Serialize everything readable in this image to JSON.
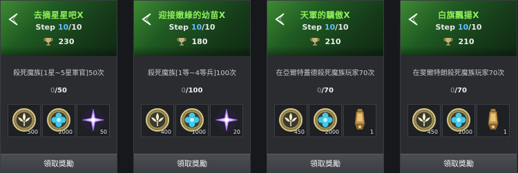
{
  "cards": [
    {
      "title": "去摘星星吧X",
      "step_prefix": "Step",
      "step_current": "10",
      "step_total": "/10",
      "points": "230",
      "description": "殺死魔族[1星~5星軍官]50次",
      "progress_current": "0",
      "progress_total": "/50",
      "rewards": [
        {
          "icon": "gold-leaf-coin-icon",
          "qty": "500"
        },
        {
          "icon": "blue-flower-coin-icon",
          "qty": "2000"
        },
        {
          "icon": "purple-star-crystal-icon",
          "qty": "50"
        }
      ],
      "claim_label": "領取獎勵"
    },
    {
      "title": "迎接嫩綠的幼苗X",
      "step_prefix": "Step",
      "step_current": "10",
      "step_total": "/10",
      "points": "180",
      "description": "殺死魔族[1等~4等兵]100次",
      "progress_current": "0",
      "progress_total": "/100",
      "rewards": [
        {
          "icon": "gold-leaf-coin-icon",
          "qty": "400"
        },
        {
          "icon": "blue-flower-coin-icon",
          "qty": "1000"
        },
        {
          "icon": "purple-star-crystal-icon",
          "qty": "20"
        }
      ],
      "claim_label": "領取獎勵"
    },
    {
      "title": "天軍的驕傲X",
      "step_prefix": "Step",
      "step_current": "10",
      "step_total": "/10",
      "points": "210",
      "description": "在亞爾特蓋德殺死魔族玩家70次",
      "progress_current": "0",
      "progress_total": "/70",
      "rewards": [
        {
          "icon": "gold-leaf-coin-icon",
          "qty": "450"
        },
        {
          "icon": "blue-flower-coin-icon",
          "qty": "2000"
        },
        {
          "icon": "bronze-lantern-scroll-icon",
          "qty": "1"
        }
      ],
      "claim_label": "領取獎勵"
    },
    {
      "title": "白旗飄揚X",
      "step_prefix": "Step",
      "step_current": "10",
      "step_total": "/10",
      "points": "210",
      "description": "在斐爾特朗殺死魔族玩家70次",
      "progress_current": "0",
      "progress_total": "/70",
      "rewards": [
        {
          "icon": "gold-leaf-coin-icon",
          "qty": "450"
        },
        {
          "icon": "blue-flower-coin-icon",
          "qty": "2000"
        },
        {
          "icon": "bronze-lantern-scroll-icon",
          "qty": "1"
        }
      ],
      "claim_label": "領取獎勵"
    }
  ],
  "colors": {
    "title_green": "#8ff05a",
    "step_blue": "#5fc0ff",
    "header_green": "#2f7a2c"
  }
}
